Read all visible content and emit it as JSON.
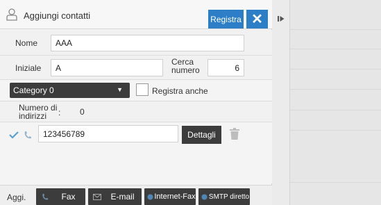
{
  "header": {
    "title": "Aggiungi contatti",
    "register_label": "Registra",
    "close_glyph": "✕"
  },
  "form": {
    "name_label": "Nome",
    "name_value": "AAA",
    "initial_label": "Iniziale",
    "initial_value": "A",
    "search_number_label_line1": "Cerca",
    "search_number_label_line2": "numero",
    "search_number_value": "6",
    "category_value": "Category 0",
    "register_also_label": "Registra anche",
    "address_count_label_line1": "Numero di",
    "address_count_label_line2": "indirizzi",
    "address_count_sep": ":",
    "address_count_value": "0"
  },
  "address_entry": {
    "number": "123456789",
    "details_label": "Dettagli"
  },
  "bottom": {
    "add_label": "Aggi.",
    "buttons": [
      {
        "label": "Fax",
        "icon": "phone-icon"
      },
      {
        "label": "E-mail",
        "icon": "mail-icon"
      },
      {
        "label": "Internet-Fax",
        "icon": "globe-icon"
      },
      {
        "label": "SMTP diretto",
        "icon": "globe-icon"
      }
    ]
  },
  "colors": {
    "accent": "#2c7fc6",
    "dark_button": "#3c3c3c"
  }
}
